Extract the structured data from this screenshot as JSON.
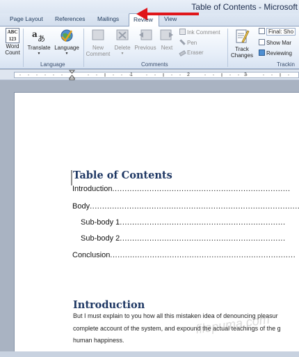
{
  "window": {
    "title": "Table of Contents - Microsoft"
  },
  "tabs": {
    "page_layout": "Page Layout",
    "references": "References",
    "mailings": "Mailings",
    "review": "Review",
    "view": "View"
  },
  "ribbon": {
    "word_count_icon": "ABC\n123",
    "word_count": "Word\nCount",
    "translate": "Translate",
    "language": "Language",
    "language_group": "Language",
    "new_comment": "New\nComment",
    "delete": "Delete",
    "previous": "Previous",
    "next": "Next",
    "ink_comment": "Ink Comment",
    "pen": "Pen",
    "eraser": "Eraser",
    "comments_group": "Comments",
    "track_changes": "Track\nChanges",
    "final_show": "Final: Sho",
    "show_markup": "Show Mar",
    "reviewing": "Reviewing",
    "tracking_group": "Trackin",
    "annotation_arrow_color": "#e0161a"
  },
  "ruler": {
    "marks": [
      "1",
      "2",
      "3"
    ]
  },
  "document": {
    "toc_title": "Table of Contents",
    "toc": [
      {
        "label": "Introduction",
        "dots": "........................................................................"
      },
      {
        "label": "Body",
        "dots": "........................................................................................"
      },
      {
        "label": "Sub-body 1",
        "dots": "..................................................................."
      },
      {
        "label": "Sub-body 2",
        "dots": "..................................................................."
      },
      {
        "label": "Conclusion",
        "dots": "..........................................................................."
      }
    ],
    "heading": "Introduction",
    "paragraph": [
      "But I must explain to you how all this mistaken idea of denouncing pleasur",
      "complete account of the system, and expound the actual teachings of the g",
      "human happiness."
    ],
    "watermark": "filepuma.com"
  }
}
